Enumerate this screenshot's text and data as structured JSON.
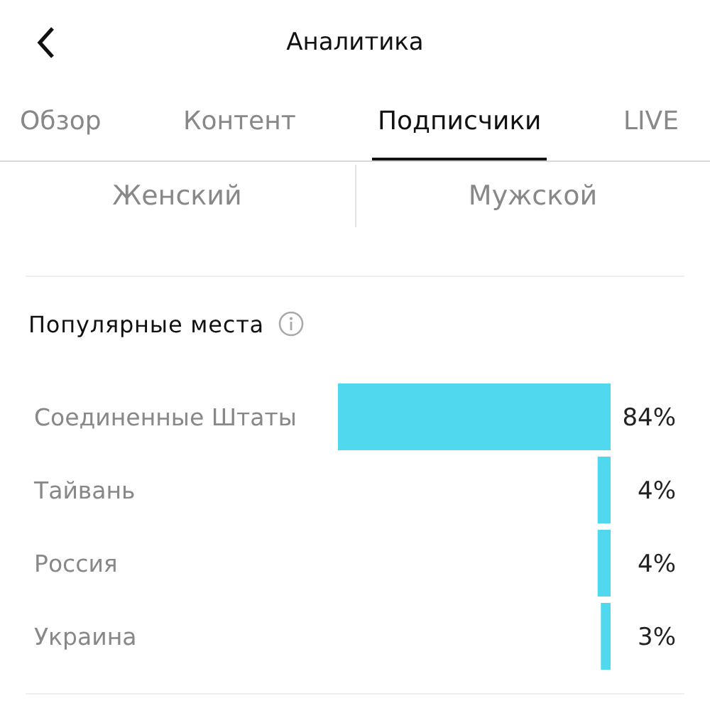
{
  "header": {
    "title": "Аналитика"
  },
  "tabs": [
    {
      "label": "Обзор",
      "selected": false
    },
    {
      "label": "Контент",
      "selected": false
    },
    {
      "label": "Подписчики",
      "selected": true
    },
    {
      "label": "LIVE",
      "selected": false
    }
  ],
  "gender_options": [
    "Женский",
    "Мужской"
  ],
  "popular_places": {
    "title": "Популярные места",
    "chart_data": {
      "type": "bar",
      "orientation": "horizontal",
      "categories": [
        "Соединенные Штаты",
        "Тайвань",
        "Россия",
        "Украина"
      ],
      "values": [
        84,
        4,
        4,
        3
      ],
      "value_labels": [
        "84%",
        "4%",
        "4%",
        "3%"
      ]
    }
  }
}
